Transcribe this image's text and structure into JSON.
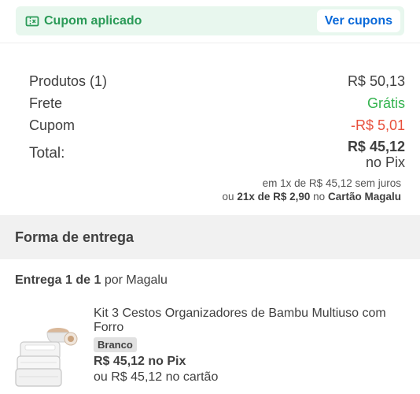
{
  "coupon": {
    "icon": "ticket-icon",
    "status_label": "Cupom aplicado",
    "view_button": "Ver cupons",
    "accent_color": "#2a9a57",
    "link_color": "#0a69d9"
  },
  "summary": {
    "products_label": "Produtos (1)",
    "products_value": "R$ 50,13",
    "shipping_label": "Frete",
    "shipping_value": "Grátis",
    "coupon_label": "Cupom",
    "coupon_value": "-R$ 5,01",
    "total_label": "Total:",
    "total_value": "R$ 45,12",
    "total_suffix": "no Pix",
    "installment_line1": "em 1x de R$ 45,12 sem juros",
    "installment_prefix": "ou",
    "installment_plan": "21x de R$ 2,90",
    "installment_mid": "no",
    "installment_card": "Cartão Magalu"
  },
  "delivery": {
    "section_title": "Forma de entrega",
    "shipment_label": "Entrega 1 de 1",
    "shipment_seller": "por Magalu",
    "product": {
      "name": "Kit 3 Cestos Organizadores de Bambu Multiuso com Forro",
      "variant": "Branco",
      "price_pix": "R$ 45,12 no Pix",
      "price_card": "ou R$ 45,12 no cartão",
      "image_icon": "product-thumbnail"
    }
  }
}
